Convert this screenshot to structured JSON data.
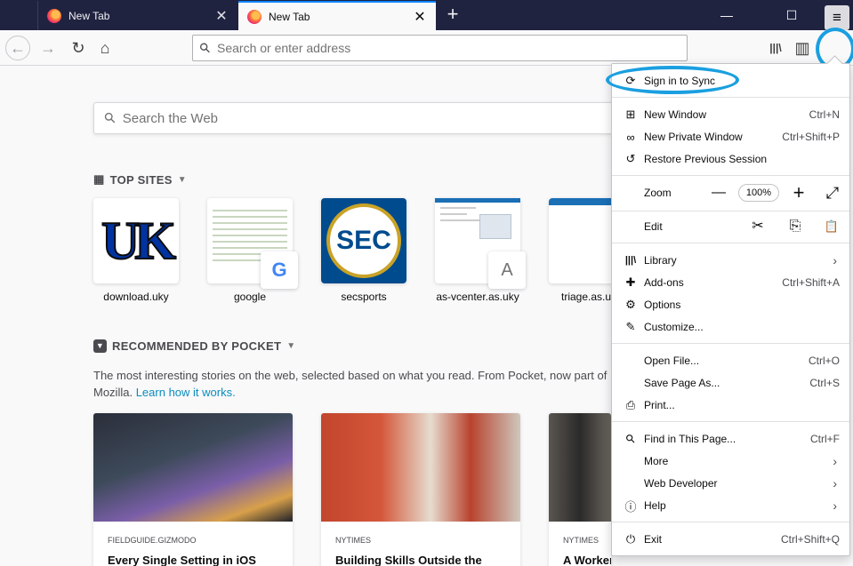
{
  "tabs": [
    {
      "title": "New Tab",
      "active": false
    },
    {
      "title": "New Tab",
      "active": true
    }
  ],
  "icons": {
    "new_tab": "+",
    "minimize": "—",
    "maximize": "☐",
    "close": "✕",
    "back": "←",
    "forward": "→",
    "reload": "↻",
    "home": "⌂",
    "search": "⚲",
    "library": "|||\\",
    "sidebar": "▥",
    "menu": "≡"
  },
  "navbar": {
    "url_placeholder": "Search or enter address"
  },
  "newtab": {
    "search_placeholder": "Search the Web",
    "top_sites_title": "TOP SITES",
    "top_sites": [
      {
        "label": "download.uky",
        "tile_text": "UK"
      },
      {
        "label": "google",
        "badge": "G"
      },
      {
        "label": "secsports",
        "tile_text": "SEC"
      },
      {
        "label": "as-vcenter.as.uky",
        "badge": "A"
      },
      {
        "label": "triage.as.uk"
      }
    ],
    "pocket_title": "RECOMMENDED BY POCKET",
    "pocket_desc": "The most interesting stories on the web, selected based on what you read. From Pocket, now part of Mozilla.",
    "pocket_learn": "Learn how it works.",
    "stories": [
      {
        "source": "FIELDGUIDE.GIZMODO",
        "headline": "Every Single Setting in iOS"
      },
      {
        "source": "NYTIMES",
        "headline": "Building Skills Outside the"
      },
      {
        "source": "NYTIMES",
        "headline": "A Worker Shortage Is"
      }
    ]
  },
  "menu": {
    "sign_in": "Sign in to Sync",
    "new_window": {
      "label": "New Window",
      "shortcut": "Ctrl+N"
    },
    "private_window": {
      "label": "New Private Window",
      "shortcut": "Ctrl+Shift+P"
    },
    "restore": {
      "label": "Restore Previous Session"
    },
    "zoom": {
      "label": "Zoom",
      "minus": "—",
      "value": "100%",
      "plus": "+",
      "fullscreen": "⤢"
    },
    "edit": {
      "label": "Edit",
      "cut": "✂",
      "copy": "⎘",
      "paste": "📋"
    },
    "library": {
      "label": "Library"
    },
    "addons": {
      "label": "Add-ons",
      "shortcut": "Ctrl+Shift+A"
    },
    "options": {
      "label": "Options"
    },
    "customize": {
      "label": "Customize..."
    },
    "open_file": {
      "label": "Open File...",
      "shortcut": "Ctrl+O"
    },
    "save_page": {
      "label": "Save Page As...",
      "shortcut": "Ctrl+S"
    },
    "print": {
      "label": "Print..."
    },
    "find": {
      "label": "Find in This Page...",
      "shortcut": "Ctrl+F"
    },
    "more": {
      "label": "More"
    },
    "web_dev": {
      "label": "Web Developer"
    },
    "help": {
      "label": "Help"
    },
    "exit": {
      "label": "Exit",
      "shortcut": "Ctrl+Shift+Q"
    }
  }
}
